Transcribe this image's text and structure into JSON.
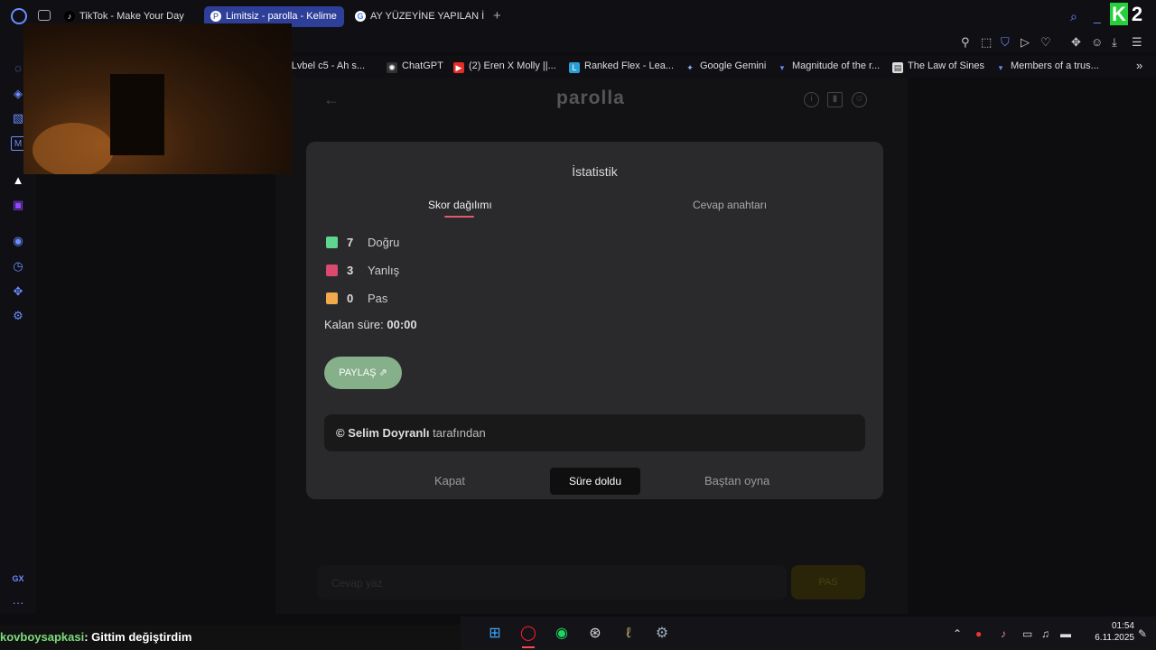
{
  "browser": {
    "tabs": [
      {
        "label": "TikTok - Make Your Day",
        "icon": "tiktok-icon",
        "active": false
      },
      {
        "label": "Limitsiz - parolla - Kelime",
        "icon": "parolla-icon",
        "active": true
      },
      {
        "label": "AY YÜZEYİNE YAPILAN İL",
        "icon": "google-icon",
        "active": false
      }
    ],
    "new_tab": "+",
    "k2_badge": {
      "letter": "K",
      "number": "2"
    },
    "bookmarks": [
      {
        "label": ") Lvbel c5 - Ah s..."
      },
      {
        "label": "ChatGPT",
        "icon": "chatgpt-icon"
      },
      {
        "label": "(2) Eren X Molly ||...",
        "icon": "youtube-icon"
      },
      {
        "label": "Ranked Flex - Lea...",
        "icon": "league-icon"
      },
      {
        "label": "Google Gemini",
        "icon": "gemini-icon"
      },
      {
        "label": "Magnitude of the r...",
        "icon": "khan-icon"
      },
      {
        "label": "The Law of Sines",
        "icon": "page-icon"
      },
      {
        "label": "Members of a trus...",
        "icon": "khan-icon"
      }
    ],
    "more_bookmarks": "»"
  },
  "sidebar": {
    "bottom_label": "GX",
    "more": "···"
  },
  "page": {
    "brand": "parolla",
    "answer_placeholder": "Cevap yaz",
    "pass_label": "PAS"
  },
  "modal": {
    "title": "İstatistik",
    "tabs": [
      "Skor dağılımı",
      "Cevap anahtarı"
    ],
    "stats": [
      {
        "count": "7",
        "label": "Doğru",
        "color": "#5fd68f"
      },
      {
        "count": "3",
        "label": "Yanlış",
        "color": "#d94a6e"
      },
      {
        "count": "0",
        "label": "Pas",
        "color": "#f0a94b"
      }
    ],
    "time_label": "Kalan süre:",
    "time_value": "00:00",
    "share_label": "PAYLAŞ ⇗",
    "credit_prefix": "©",
    "credit_name": "Selim Doyranlı",
    "credit_suffix": "tarafından",
    "footer": {
      "close": "Kapat",
      "expired": "Süre doldu",
      "restart": "Baştan oyna"
    }
  },
  "stream_chat": {
    "user": "kovboysapkasi",
    "message": ": Gittim değiştirdim"
  },
  "taskbar": {
    "clock_time": "01:54",
    "clock_date": "6.11.2025"
  }
}
